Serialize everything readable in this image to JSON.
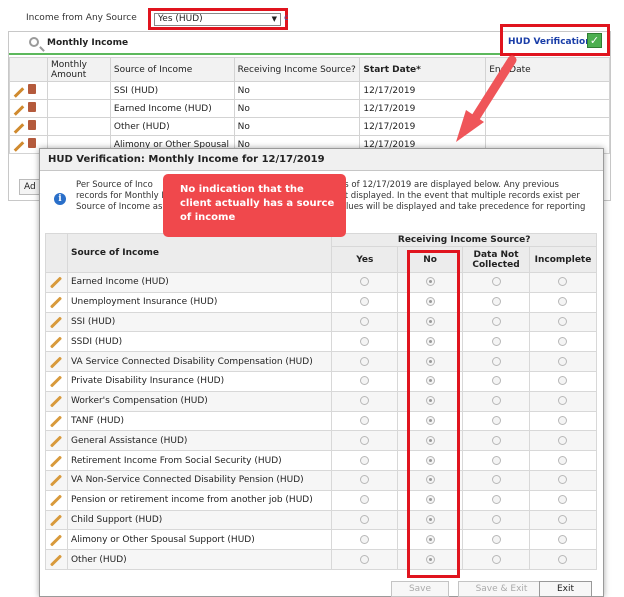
{
  "form": {
    "field_label": "Income from Any Source",
    "select_value": "Yes (HUD)",
    "select_extra": "c"
  },
  "panel": {
    "title": "Monthly Income",
    "hud_verification_link": "HUD Verification",
    "add_button": "Ad",
    "columns": [
      "Monthly Amount",
      "Source of Income",
      "Receiving Income Source?",
      "Start Date*",
      "End Date"
    ],
    "rows": [
      {
        "amount": "",
        "source": "SSI (HUD)",
        "receiving": "No",
        "start": "12/17/2019",
        "end": ""
      },
      {
        "amount": "",
        "source": "Earned Income (HUD)",
        "receiving": "No",
        "start": "12/17/2019",
        "end": ""
      },
      {
        "amount": "",
        "source": "Other (HUD)",
        "receiving": "No",
        "start": "12/17/2019",
        "end": ""
      },
      {
        "amount": "",
        "source": "Alimony or Other Spousal",
        "receiving": "No",
        "start": "12/17/2019",
        "end": ""
      }
    ]
  },
  "modal": {
    "title": "HUD Verification: Monthly Income for 12/17/2019",
    "info_lines": [
      "Per Source of Inco                                                                  e as of 12/17/2019 are displayed below. Any previous",
      "records for Monthly In                                                               ot displayed. In the event that multiple records exist per",
      "Source of Income as                                                                  alues will be displayed and take precedence for reporting"
    ],
    "col_source": "Source of Income",
    "col_group": "Receiving Income Source?",
    "col_yes": "Yes",
    "col_no": "No",
    "col_dnc": "Data Not Collected",
    "col_incomplete": "Incomplete",
    "rows": [
      {
        "source": "Earned Income (HUD)",
        "selected": "no"
      },
      {
        "source": "Unemployment Insurance (HUD)",
        "selected": "no"
      },
      {
        "source": "SSI (HUD)",
        "selected": "no"
      },
      {
        "source": "SSDI (HUD)",
        "selected": "no"
      },
      {
        "source": "VA Service Connected Disability Compensation (HUD)",
        "selected": "no"
      },
      {
        "source": "Private Disability Insurance (HUD)",
        "selected": "no"
      },
      {
        "source": "Worker's Compensation (HUD)",
        "selected": "no"
      },
      {
        "source": "TANF (HUD)",
        "selected": "no"
      },
      {
        "source": "General Assistance (HUD)",
        "selected": "no"
      },
      {
        "source": "Retirement Income From Social Security (HUD)",
        "selected": "no"
      },
      {
        "source": "VA Non-Service Connected Disability Pension (HUD)",
        "selected": "no"
      },
      {
        "source": "Pension or retirement income from another job (HUD)",
        "selected": "no"
      },
      {
        "source": "Child Support (HUD)",
        "selected": "no"
      },
      {
        "source": "Alimony or Other Spousal Support (HUD)",
        "selected": "no"
      },
      {
        "source": "Other (HUD)",
        "selected": "no"
      }
    ],
    "buttons": {
      "save": "Save",
      "save_exit": "Save & Exit",
      "exit": "Exit"
    }
  },
  "callout": {
    "text": "No indication that the client actually has a source of income"
  },
  "colors": {
    "highlight_red": "#e0141e",
    "callout_red": "#f0484c",
    "link_blue": "#1a3ea8",
    "check_green": "#4caf50"
  }
}
